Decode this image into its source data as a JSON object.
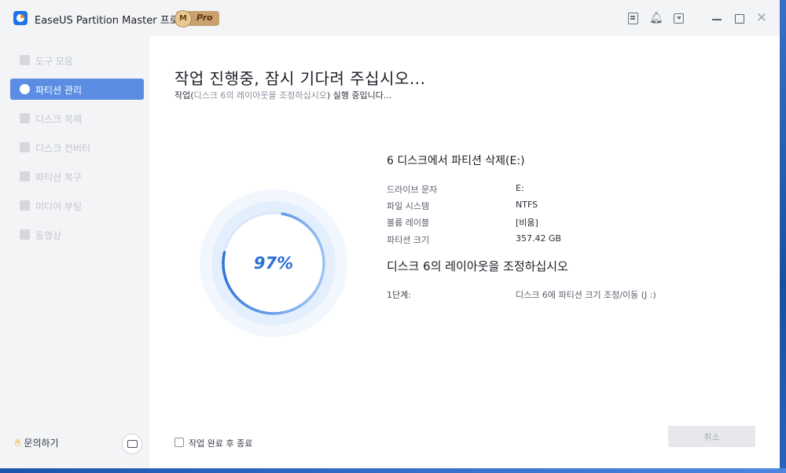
{
  "app": {
    "title": "EaseUS Partition Master 프로 버전",
    "badge_letter": "M",
    "badge_text": "Pro",
    "accent_color": "#1e73e8"
  },
  "titlebar_icons": [
    "notes-icon",
    "bell-icon",
    "dropdown-box-icon",
    "minimize-icon",
    "maximize-icon",
    "close-icon"
  ],
  "sidebar": {
    "items": [
      {
        "label": "도구 모음",
        "icon": "toolbox-icon",
        "active": false
      },
      {
        "label": "파티션 관리",
        "icon": "pie-chart-icon",
        "active": true
      },
      {
        "label": "디스크 복제",
        "icon": "clone-icon",
        "active": false
      },
      {
        "label": "디스크 컨버터",
        "icon": "convert-icon",
        "active": false
      },
      {
        "label": "파티션 복구",
        "icon": "recover-icon",
        "active": false
      },
      {
        "label": "미디어 부팅",
        "icon": "usb-icon",
        "active": false
      },
      {
        "label": "동영상",
        "icon": "video-icon",
        "active": false
      }
    ],
    "help_label": "문의하기"
  },
  "main": {
    "title": "작업 진행중, 잠시 기다려 주십시오...",
    "subtitle_prefix": "작업(",
    "subtitle_task": "디스크 6의 레이아웃을 조정하십시오",
    "subtitle_suffix": ") 실행 중입니다...",
    "progress_label": "97%",
    "progress_fraction": 0.97,
    "operation_title": "6 디스크에서 파티션 삭제(E:)",
    "details": [
      {
        "label": "드라이브 문자",
        "value": "E:"
      },
      {
        "label": "파일 시스템",
        "value": "NTFS"
      },
      {
        "label": "볼륨 레이블",
        "value": "[비움]"
      },
      {
        "label": "파티션 크기",
        "value": "357.42 GB"
      }
    ],
    "step_title": "디스크 6의 레이아웃을 조정하십시오",
    "step_label": "1단계:",
    "step_value": "디스크 6에 파티션 크기 조정/이동 (J :)",
    "shutdown_label": "작업 완료 후 종료",
    "cancel_label": "취소"
  }
}
